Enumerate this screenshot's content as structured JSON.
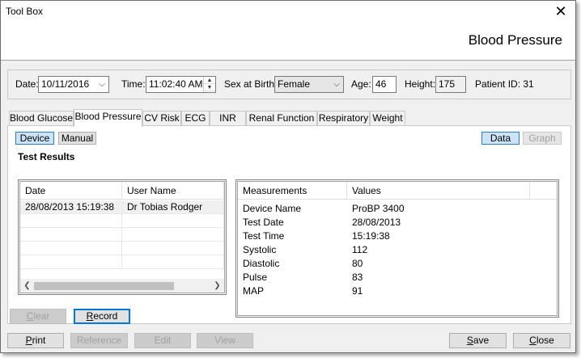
{
  "window": {
    "title": "Tool Box",
    "close_glyph": "✕",
    "heading": "Blood Pressure"
  },
  "info": {
    "date_label": "Date:",
    "date_value": "10/11/2016",
    "time_label": "Time:",
    "time_value": "11:02:40 AM",
    "sex_label": "Sex at Birth:",
    "sex_value": "Female",
    "age_label": "Age:",
    "age_value": "46",
    "height_label": "Height:",
    "height_value": "175",
    "patient_id": "Patient ID: 31"
  },
  "tabs": [
    "Blood Glucose",
    "Blood Pressure",
    "CV Risk",
    "ECG",
    "INR",
    "Renal Function",
    "Respiratory",
    "Weight"
  ],
  "active_tab": "Blood Pressure",
  "panel": {
    "device_label": "Device",
    "manual_label": "Manual",
    "data_label": "Data",
    "graph_label": "Graph",
    "section_title": "Test Results"
  },
  "results_table": {
    "columns": [
      "Date",
      "User Name"
    ],
    "rows": [
      [
        "28/08/2013 15:19:38",
        "Dr Tobias Rodger"
      ]
    ]
  },
  "measurements_table": {
    "columns": [
      "Measurements",
      "Values"
    ],
    "rows": [
      [
        "Device Name",
        "ProBP 3400"
      ],
      [
        "Test Date",
        "28/08/2013"
      ],
      [
        "Test Time",
        "15:19:38"
      ],
      [
        "Systolic",
        "112"
      ],
      [
        "Diastolic",
        "80"
      ],
      [
        "Pulse",
        "83"
      ],
      [
        "MAP",
        "91"
      ]
    ]
  },
  "buttons": {
    "clear": {
      "first": "C",
      "rest": "lear"
    },
    "record": {
      "first": "R",
      "rest": "ecord"
    },
    "print": {
      "first": "P",
      "rest": "rint"
    },
    "reference": "Reference",
    "edit": "Edit",
    "view": "View",
    "save": {
      "first": "S",
      "rest": "ave"
    },
    "close": {
      "first": "C",
      "rest": "lose"
    }
  },
  "colors": {
    "accent_selected": "#cce4f7",
    "accent_border": "#2f7ac4",
    "focus_border": "#0078d7"
  }
}
